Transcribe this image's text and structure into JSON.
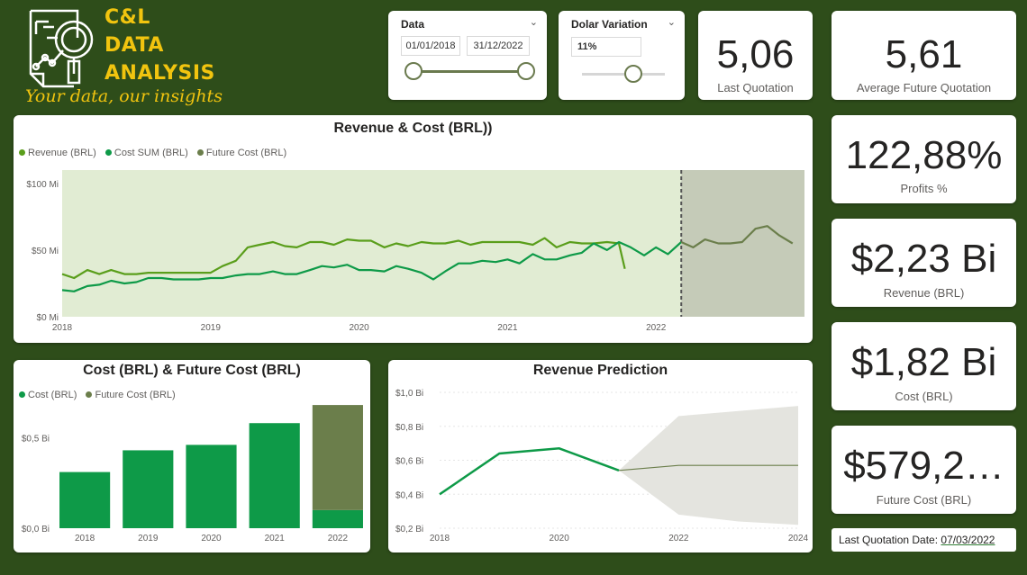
{
  "logo": {
    "lines": [
      "C&L",
      "DATA",
      "ANALYSIS"
    ],
    "tagline": "Your data, our insights",
    "icon": "magnifier-chart-document-icon"
  },
  "slicers": {
    "date": {
      "title": "Data",
      "start": "01/01/2018",
      "end": "31/12/2022",
      "range_fraction": [
        0,
        1
      ]
    },
    "dollar": {
      "title": "Dolar Variation",
      "value": "11%",
      "slider_fraction": 0.6
    }
  },
  "kpis": {
    "last_quotation": {
      "value": "5,06",
      "label": "Last Quotation"
    },
    "avg_future_quotation": {
      "value": "5,61",
      "label": "Average Future Quotation"
    },
    "profits": {
      "value": "122,88%",
      "label": "Profits %"
    },
    "revenue": {
      "value": "$2,23 Bi",
      "label": "Revenue (BRL)"
    },
    "cost": {
      "value": "$1,82 Bi",
      "label": "Cost (BRL)"
    },
    "future_cost": {
      "value": "$579,2…",
      "label": "Future Cost (BRL)"
    }
  },
  "last_quotation_date": {
    "label": "Last Quotation Date:",
    "value": "07/03/2022"
  },
  "colors": {
    "background": "#2e4d1a",
    "revenue": "#5a9e1b",
    "cost": "#0e9a48",
    "future": "#6b7e4b",
    "area_history": "#e1ecd3",
    "area_forecast": "#c5cbb8",
    "forecast_band": "#e4e4df",
    "logo": "#f1c40f"
  },
  "chart_data": [
    {
      "id": "revenue_cost",
      "type": "line",
      "title": "Revenue & Cost (BRL))",
      "legend": [
        "Revenue (BRL)",
        "Cost SUM (BRL)",
        "Future Cost (BRL)"
      ],
      "x_ticks": [
        "2018",
        "2019",
        "2020",
        "2021",
        "2022"
      ],
      "y_ticks": [
        "$0 Mi",
        "$50 Mi",
        "$100 Mi"
      ],
      "ylim": [
        0,
        110
      ],
      "xlim": [
        2018.0,
        2023.0
      ],
      "forecast_start": 2022.17,
      "series": [
        {
          "name": "Revenue (BRL)",
          "x": [
            2018.0,
            2018.08,
            2018.17,
            2018.25,
            2018.33,
            2018.42,
            2018.5,
            2018.58,
            2018.67,
            2018.75,
            2018.83,
            2018.92,
            2019.0,
            2019.08,
            2019.17,
            2019.25,
            2019.33,
            2019.42,
            2019.5,
            2019.58,
            2019.67,
            2019.75,
            2019.83,
            2019.92,
            2020.0,
            2020.08,
            2020.17,
            2020.25,
            2020.33,
            2020.42,
            2020.5,
            2020.58,
            2020.67,
            2020.75,
            2020.83,
            2020.92,
            2021.0,
            2021.08,
            2021.17,
            2021.25,
            2021.33,
            2021.42,
            2021.5,
            2021.58,
            2021.67,
            2021.75,
            2021.79
          ],
          "values": [
            32,
            29,
            35,
            32,
            35,
            32,
            32,
            33,
            33,
            33,
            33,
            33,
            33,
            38,
            42,
            52,
            54,
            56,
            53,
            52,
            56,
            56,
            54,
            58,
            57,
            57,
            52,
            55,
            53,
            56,
            55,
            55,
            57,
            54,
            56,
            56,
            56,
            56,
            54,
            59,
            52,
            56,
            55,
            55,
            56,
            55,
            36
          ]
        },
        {
          "name": "Cost SUM (BRL)",
          "x": [
            2018.0,
            2018.08,
            2018.17,
            2018.25,
            2018.33,
            2018.42,
            2018.5,
            2018.58,
            2018.67,
            2018.75,
            2018.83,
            2018.92,
            2019.0,
            2019.08,
            2019.17,
            2019.25,
            2019.33,
            2019.42,
            2019.5,
            2019.58,
            2019.67,
            2019.75,
            2019.83,
            2019.92,
            2020.0,
            2020.08,
            2020.17,
            2020.25,
            2020.33,
            2020.42,
            2020.5,
            2020.58,
            2020.67,
            2020.75,
            2020.83,
            2020.92,
            2021.0,
            2021.08,
            2021.17,
            2021.25,
            2021.33,
            2021.42,
            2021.5,
            2021.58,
            2021.67,
            2021.75,
            2021.83,
            2021.92,
            2022.0,
            2022.08,
            2022.17
          ],
          "values": [
            20,
            19,
            23,
            24,
            27,
            25,
            26,
            29,
            29,
            28,
            28,
            28,
            29,
            29,
            31,
            32,
            32,
            34,
            32,
            32,
            35,
            38,
            37,
            39,
            35,
            35,
            34,
            38,
            36,
            33,
            28,
            34,
            40,
            40,
            42,
            41,
            43,
            40,
            47,
            43,
            43,
            46,
            48,
            55,
            50,
            56,
            52,
            46,
            52,
            47,
            56
          ]
        },
        {
          "name": "Future Cost (BRL)",
          "x": [
            2022.17,
            2022.25,
            2022.33,
            2022.42,
            2022.5,
            2022.58,
            2022.67,
            2022.75,
            2022.83,
            2022.92
          ],
          "values": [
            56,
            52,
            58,
            55,
            55,
            56,
            66,
            68,
            61,
            55
          ]
        }
      ]
    },
    {
      "id": "cost_future_cost",
      "type": "bar",
      "title": "Cost (BRL) & Future Cost (BRL)",
      "legend": [
        "Cost (BRL)",
        "Future Cost (BRL)"
      ],
      "categories": [
        "2018",
        "2019",
        "2020",
        "2021",
        "2022"
      ],
      "y_ticks": [
        "$0,0 Bi",
        "$0,5 Bi"
      ],
      "ylim": [
        0,
        0.75
      ],
      "series": [
        {
          "name": "Cost (BRL)",
          "values": [
            0.31,
            0.43,
            0.46,
            0.58,
            0.1
          ]
        },
        {
          "name": "Future Cost (BRL)",
          "values": [
            0,
            0,
            0,
            0,
            0.58
          ]
        }
      ]
    },
    {
      "id": "revenue_prediction",
      "type": "line",
      "title": "Revenue Prediction",
      "x_ticks": [
        "2018",
        "2020",
        "2022",
        "2024"
      ],
      "y_ticks": [
        "$0,2 Bi",
        "$0,4 Bi",
        "$0,6 Bi",
        "$0,8 Bi",
        "$1,0 Bi"
      ],
      "xlim": [
        2018,
        2024
      ],
      "ylim": [
        0.2,
        1.0
      ],
      "series": [
        {
          "name": "Revenue",
          "x": [
            2018,
            2019,
            2020,
            2021
          ],
          "values": [
            0.4,
            0.64,
            0.67,
            0.54
          ]
        },
        {
          "name": "Forecast",
          "x": [
            2021,
            2022,
            2023,
            2024
          ],
          "values": [
            0.54,
            0.57,
            0.57,
            0.57
          ]
        }
      ],
      "band": {
        "x": [
          2021,
          2022,
          2023,
          2024
        ],
        "upper": [
          0.54,
          0.86,
          0.89,
          0.92
        ],
        "lower": [
          0.54,
          0.28,
          0.24,
          0.22
        ]
      }
    }
  ]
}
